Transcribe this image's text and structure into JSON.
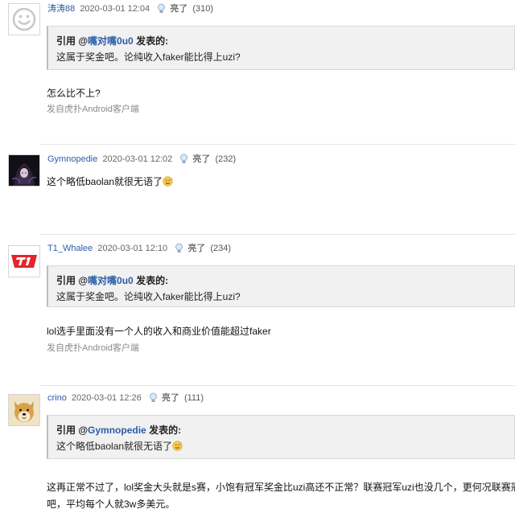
{
  "posts": [
    {
      "username": "涛涛88",
      "time": "2020-03-01 12:04",
      "light_label": "亮了",
      "light_count": "(310)",
      "avatar": "smiley-placeholder",
      "quote": {
        "prefix": "引用 @",
        "author": "嘴对嘴0u0",
        "suffix": " 发表的:",
        "text": "这属于奖金吧。论纯收入faker能比得上uzi?"
      },
      "body": "怎么比不上?",
      "client": "发自虎扑Android客户端"
    },
    {
      "username": "Gymnopedie",
      "time": "2020-03-01 12:02",
      "light_label": "亮了",
      "light_count": "(232)",
      "avatar": "dark-anime-portrait",
      "body": "这个略低baolan就很无语了",
      "body_emoji": "sweat-smile-emoji"
    },
    {
      "username": "T1_Whalee",
      "time": "2020-03-01 12:10",
      "light_label": "亮了",
      "light_count": "(234)",
      "avatar": "t1-logo",
      "quote": {
        "prefix": "引用 @",
        "author": "嘴对嘴0u0",
        "suffix": " 发表的:",
        "text": "这属于奖金吧。论纯收入faker能比得上uzi?"
      },
      "body": "lol选手里面没有一个人的收入和商业价值能超过faker",
      "client": "发自虎扑Android客户端"
    },
    {
      "username": "crino",
      "time": "2020-03-01 12:26",
      "light_label": "亮了",
      "light_count": "(111)",
      "avatar": "doge-dog",
      "quote": {
        "prefix": "引用 @",
        "author": "Gymnopedie",
        "suffix": " 发表的:",
        "text": "这个略低baolan就很无语了",
        "text_emoji": "sweat-smile-emoji"
      },
      "body_line1": "这再正常不过了，lol奖金大头就是s赛，小饱有冠军奖金比uzi高还不正常？联赛冠军uzi也没几个，更何况联赛冠",
      "body_line2": "吧，平均每个人就3w多美元。"
    }
  ],
  "colors": {
    "username": "#2b5ca8",
    "quote_bg": "#f1f1f1",
    "client_text": "#8a8a8a"
  }
}
